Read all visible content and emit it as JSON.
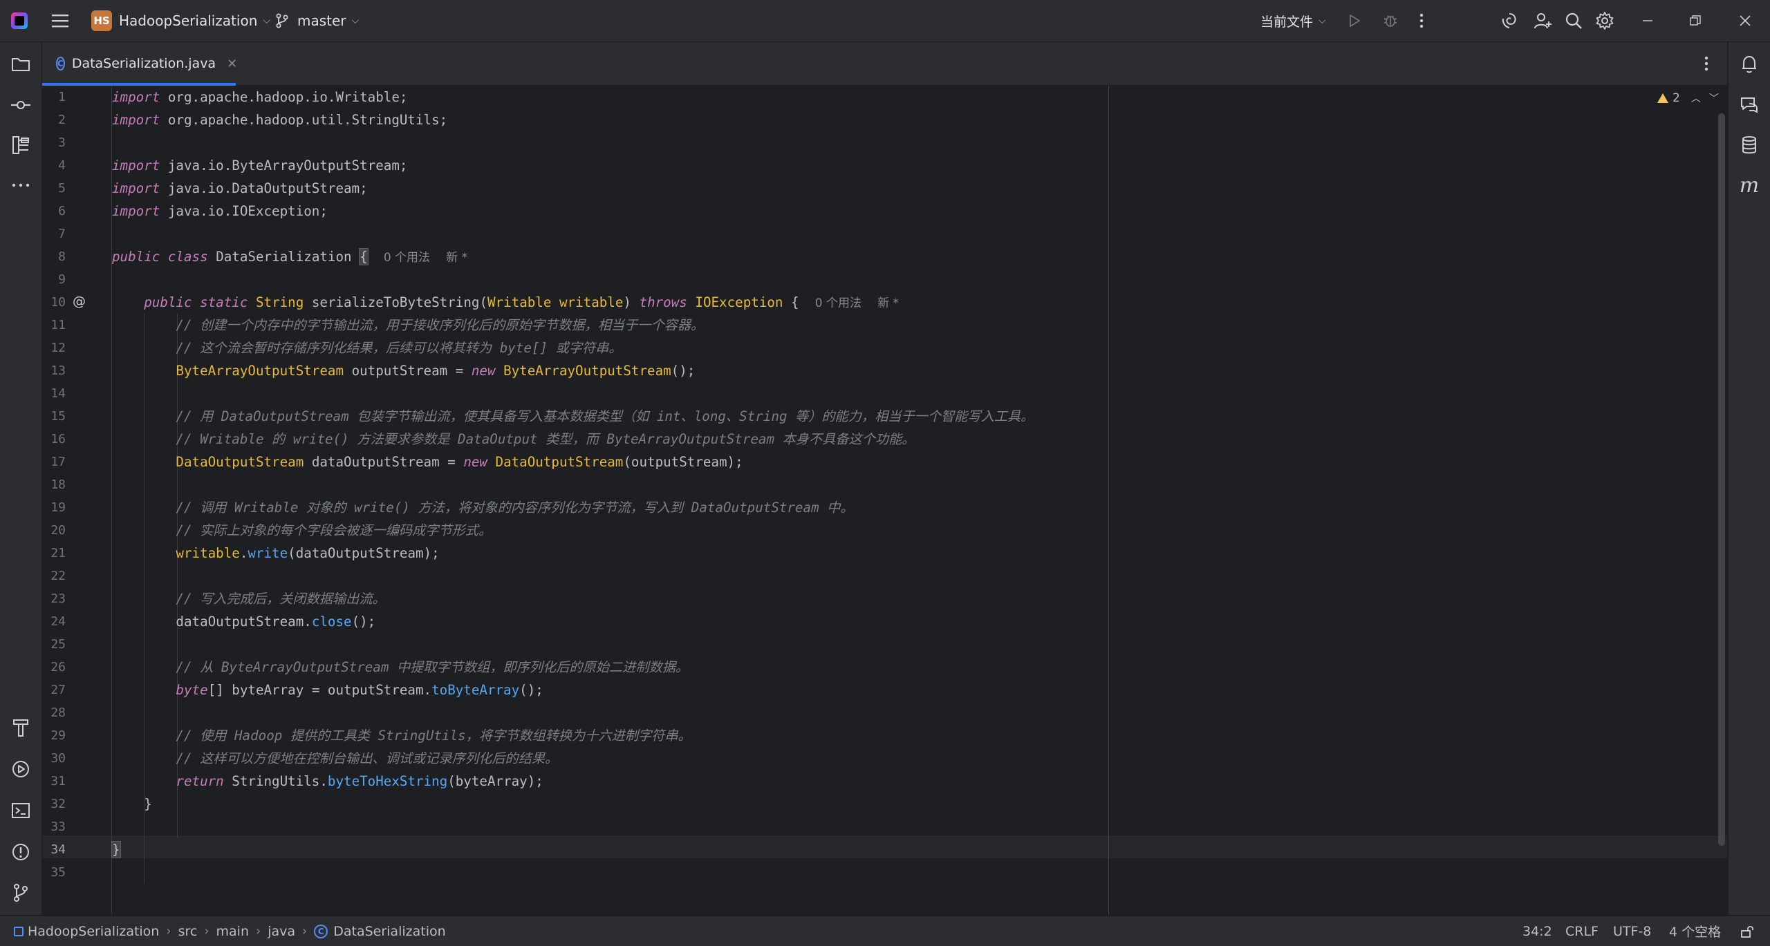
{
  "titlebar": {
    "project_badge": "HS",
    "project_name": "HadoopSerialization",
    "branch": "master",
    "run_config": "当前文件"
  },
  "tab": {
    "filename": "DataSerialization.java",
    "class_glyph": "C"
  },
  "editor": {
    "warning_count": "2",
    "line_numbers": [
      "1",
      "2",
      "3",
      "4",
      "5",
      "6",
      "7",
      "8",
      "9",
      "10",
      "11",
      "12",
      "13",
      "14",
      "15",
      "16",
      "17",
      "18",
      "19",
      "20",
      "21",
      "22",
      "23",
      "24",
      "25",
      "26",
      "27",
      "28",
      "29",
      "30",
      "31",
      "32",
      "33",
      "34",
      "35"
    ],
    "at_marker": "@",
    "hints": {
      "class_usages": "0 个用法",
      "class_new": "新 *",
      "method_usages": "0 个用法",
      "method_new": "新 *"
    },
    "code": {
      "l1": {
        "kw": "import",
        "rest": " org.apache.hadoop.io.Writable;"
      },
      "l2": {
        "kw": "import",
        "rest": " org.apache.hadoop.util.StringUtils;"
      },
      "l4": {
        "kw": "import",
        "rest": " java.io.ByteArrayOutputStream;"
      },
      "l5": {
        "kw": "import",
        "rest": " java.io.DataOutputStream;"
      },
      "l6": {
        "kw": "import",
        "rest": " java.io.IOException;"
      },
      "l8": {
        "kw1": "public",
        "kw2": "class",
        "name": "DataSerialization",
        "brace": "{"
      },
      "l10": {
        "kw1": "public",
        "kw2": "static",
        "ret": "String",
        "name": "serializeToByteString",
        "p_open": "(",
        "p_type": "Writable",
        "p_name": "writable",
        "p_close": ")",
        "throws": "throws",
        "exc": "IOException",
        "brace": "{"
      },
      "l11": "// 创建一个内存中的字节输出流，用于接收序列化后的原始字节数据，相当于一个容器。",
      "l12": "// 这个流会暂时存储序列化结果，后续可以将其转为 byte[] 或字符串。",
      "l13": {
        "type": "ByteArrayOutputStream",
        "mid": " outputStream = ",
        "new": "new",
        "ctor": "ByteArrayOutputStream",
        "end": "();"
      },
      "l15": "// 用 DataOutputStream 包装字节输出流，使其具备写入基本数据类型（如 int、long、String 等）的能力，相当于一个智能写入工具。",
      "l16": "// Writable 的 write() 方法要求参数是 DataOutput 类型，而 ByteArrayOutputStream 本身不具备这个功能。",
      "l17": {
        "type": "DataOutputStream",
        "mid": " dataOutputStream = ",
        "new": "new",
        "ctor": "DataOutputStream",
        "end": "(outputStream);"
      },
      "l19": "// 调用 Writable 对象的 write() 方法，将对象的内容序列化为字节流，写入到 DataOutputStream 中。",
      "l20": "// 实际上对象的每个字段会被逐一编码成字节形式。",
      "l21": {
        "obj": "writable",
        "dot": ".",
        "call": "write",
        "end": "(dataOutputStream);"
      },
      "l23": "// 写入完成后，关闭数据输出流。",
      "l24": {
        "obj": "dataOutputStream.",
        "call": "close",
        "end": "();"
      },
      "l26": "// 从 ByteArrayOutputStream 中提取字节数组，即序列化后的原始二进制数据。",
      "l27": {
        "kw": "byte",
        "mid": "[] byteArray = outputStream.",
        "call": "toByteArray",
        "end": "();"
      },
      "l29": "// 使用 Hadoop 提供的工具类 StringUtils，将字节数组转换为十六进制字符串。",
      "l30": "// 这样可以方便地在控制台输出、调试或记录序列化后的结果。",
      "l31": {
        "kw": "return",
        "obj": " StringUtils.",
        "call": "byteToHexString",
        "end": "(byteArray);"
      },
      "l32": "}",
      "l34": "}"
    }
  },
  "statusbar": {
    "breadcrumbs": [
      "HadoopSerialization",
      "src",
      "main",
      "java",
      "DataSerialization"
    ],
    "position": "34:2",
    "line_ending": "CRLF",
    "encoding": "UTF-8",
    "indent": "4 个空格"
  }
}
